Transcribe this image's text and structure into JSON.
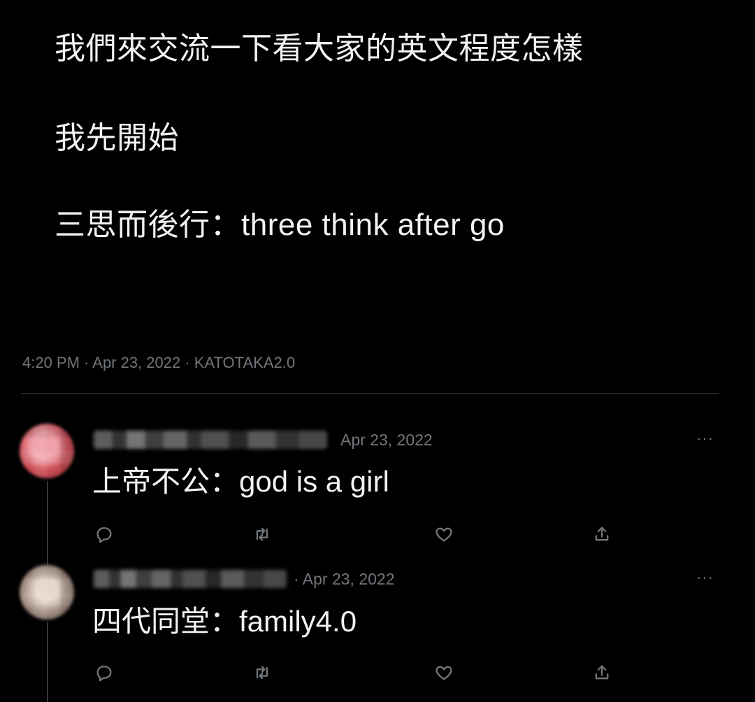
{
  "post": {
    "lines": [
      "我們來交流一下看大家的英文程度怎樣",
      "我先開始",
      "三思而後行：three think after go"
    ],
    "meta": "4:20 PM · Apr 23, 2022 · KATOTAKA2.0"
  },
  "replies": [
    {
      "date": "Apr 23, 2022",
      "text": "上帝不公：god is a girl",
      "more": "···"
    },
    {
      "date": "· Apr 23, 2022",
      "text": "四代同堂：family4.0",
      "more": "···"
    }
  ],
  "icons": {
    "reply": "reply-icon",
    "retweet": "retweet-icon",
    "like": "like-icon",
    "share": "share-icon"
  },
  "colors": {
    "background": "#000000",
    "text": "#f2f2f2",
    "muted": "#71767b",
    "divider": "#2f3336"
  }
}
